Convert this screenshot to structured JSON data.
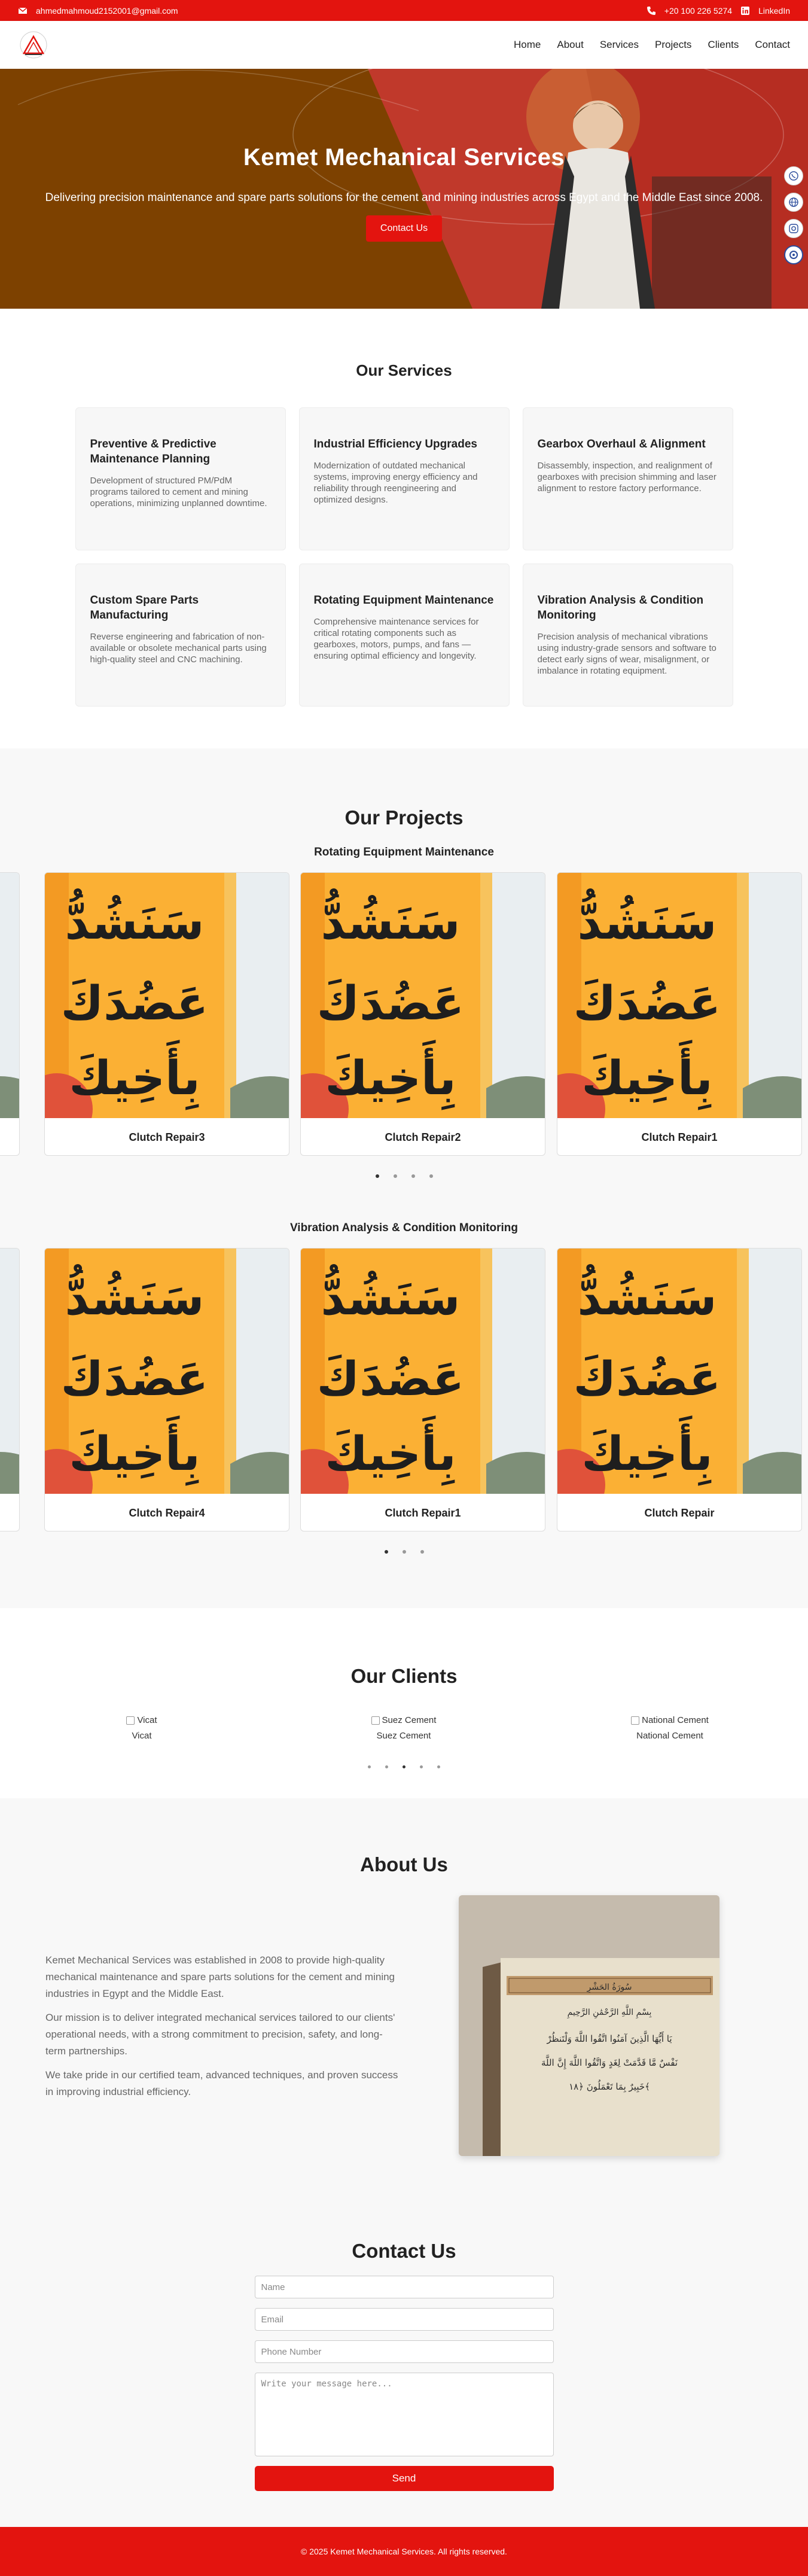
{
  "topbar": {
    "email": "ahmedmahmoud2152001@gmail.com",
    "phone": "+20 100 226 5274",
    "linkedin": "LinkedIn"
  },
  "nav": {
    "links": [
      "Home",
      "About",
      "Services",
      "Projects",
      "Clients",
      "Contact"
    ]
  },
  "hero": {
    "title": "Kemet Mechanical Services",
    "subtitle": "Delivering precision maintenance and spare parts solutions for the cement and mining industries across Egypt and the Middle East since 2008.",
    "cta": "Contact Us"
  },
  "services": {
    "title": "Our Services",
    "items": [
      {
        "title": "Preventive & Predictive Maintenance Planning",
        "desc": "Development of structured PM/PdM programs tailored to cement and mining operations, minimizing unplanned downtime."
      },
      {
        "title": "Industrial Efficiency Upgrades",
        "desc": "Modernization of outdated mechanical systems, improving energy efficiency and reliability through reengineering and optimized designs."
      },
      {
        "title": "Gearbox Overhaul & Alignment",
        "desc": "Disassembly, inspection, and realignment of gearboxes with precision shimming and laser alignment to restore factory performance."
      },
      {
        "title": "Custom Spare Parts Manufacturing",
        "desc": "Reverse engineering and fabrication of non-available or obsolete mechanical parts using high-quality steel and CNC machining."
      },
      {
        "title": "Rotating Equipment Maintenance",
        "desc": "Comprehensive maintenance services for critical rotating components such as gearboxes, motors, pumps, and fans — ensuring optimal efficiency and longevity."
      },
      {
        "title": "Vibration Analysis & Condition Monitoring",
        "desc": "Precision analysis of mechanical vibrations using industry-grade sensors and software to detect early signs of wear, misalignment, or imbalance in rotating equipment."
      }
    ]
  },
  "projects": {
    "title": "Our Projects",
    "groups": [
      {
        "title": "Rotating Equipment Maintenance",
        "captions": [
          "Clutch Repair3",
          "Clutch Repair2",
          "Clutch Repair1"
        ],
        "dots": 4,
        "active_dot": 0
      },
      {
        "title": "Vibration Analysis & Condition Monitoring",
        "captions": [
          "Clutch Repair4",
          "Clutch Repair1",
          "Clutch Repair"
        ],
        "dots": 3,
        "active_dot": 0
      }
    ],
    "image_text": [
      "سَنَشُدُّ",
      "عَضُدَكَ",
      "بِأَخِيكَ"
    ]
  },
  "clients": {
    "title": "Our Clients",
    "items": [
      {
        "alt": "Vicat",
        "name": "Vicat"
      },
      {
        "alt": "Suez Cement",
        "name": "Suez Cement"
      },
      {
        "alt": "National Cement",
        "name": "National Cement"
      }
    ],
    "dots": 5,
    "active_dot": 2
  },
  "about": {
    "title": "About Us",
    "paragraphs": [
      "Kemet Mechanical Services was established in 2008 to provide high-quality mechanical maintenance and spare parts solutions for the cement and mining industries in Egypt and the Middle East.",
      "Our mission is to deliver integrated mechanical services tailored to our clients' operational needs, with a strong commitment to precision, safety, and long-term partnerships.",
      "We take pride in our certified team, advanced techniques, and proven success in improving industrial efficiency."
    ],
    "book_header": "سُورَةُ الحَشْرِ",
    "book_lines": [
      "بِسْمِ اللَّهِ الرَّحْمَٰنِ الرَّحِيمِ",
      "يَا أَيُّهَا الَّذِينَ آمَنُوا اتَّقُوا اللَّهَ وَلْتَنظُرْ",
      "نَفْسٌ مَّا قَدَّمَتْ لِغَدٍ وَاتَّقُوا اللَّهَ إِنَّ اللَّهَ",
      "خَبِيرٌ بِمَا تَعْمَلُونَ ﴿١٨﴾"
    ]
  },
  "contact": {
    "title": "Contact Us",
    "name_placeholder": "Name",
    "email_placeholder": "Email",
    "phone_placeholder": "Phone Number",
    "message_placeholder": "Write your message here...",
    "send": "Send"
  },
  "footer": {
    "text": "© 2025 Kemet Mechanical Services. All rights reserved."
  },
  "colors": {
    "brand_red": "#e3140f",
    "hero_brown": "#7a3b00",
    "light_bg": "#f8f8f8"
  },
  "icons": [
    "envelope-icon",
    "phone-icon",
    "linkedin-icon",
    "whatsapp-icon",
    "globe-icon",
    "instagram-icon",
    "chat-icon",
    "broken-image-icon"
  ]
}
